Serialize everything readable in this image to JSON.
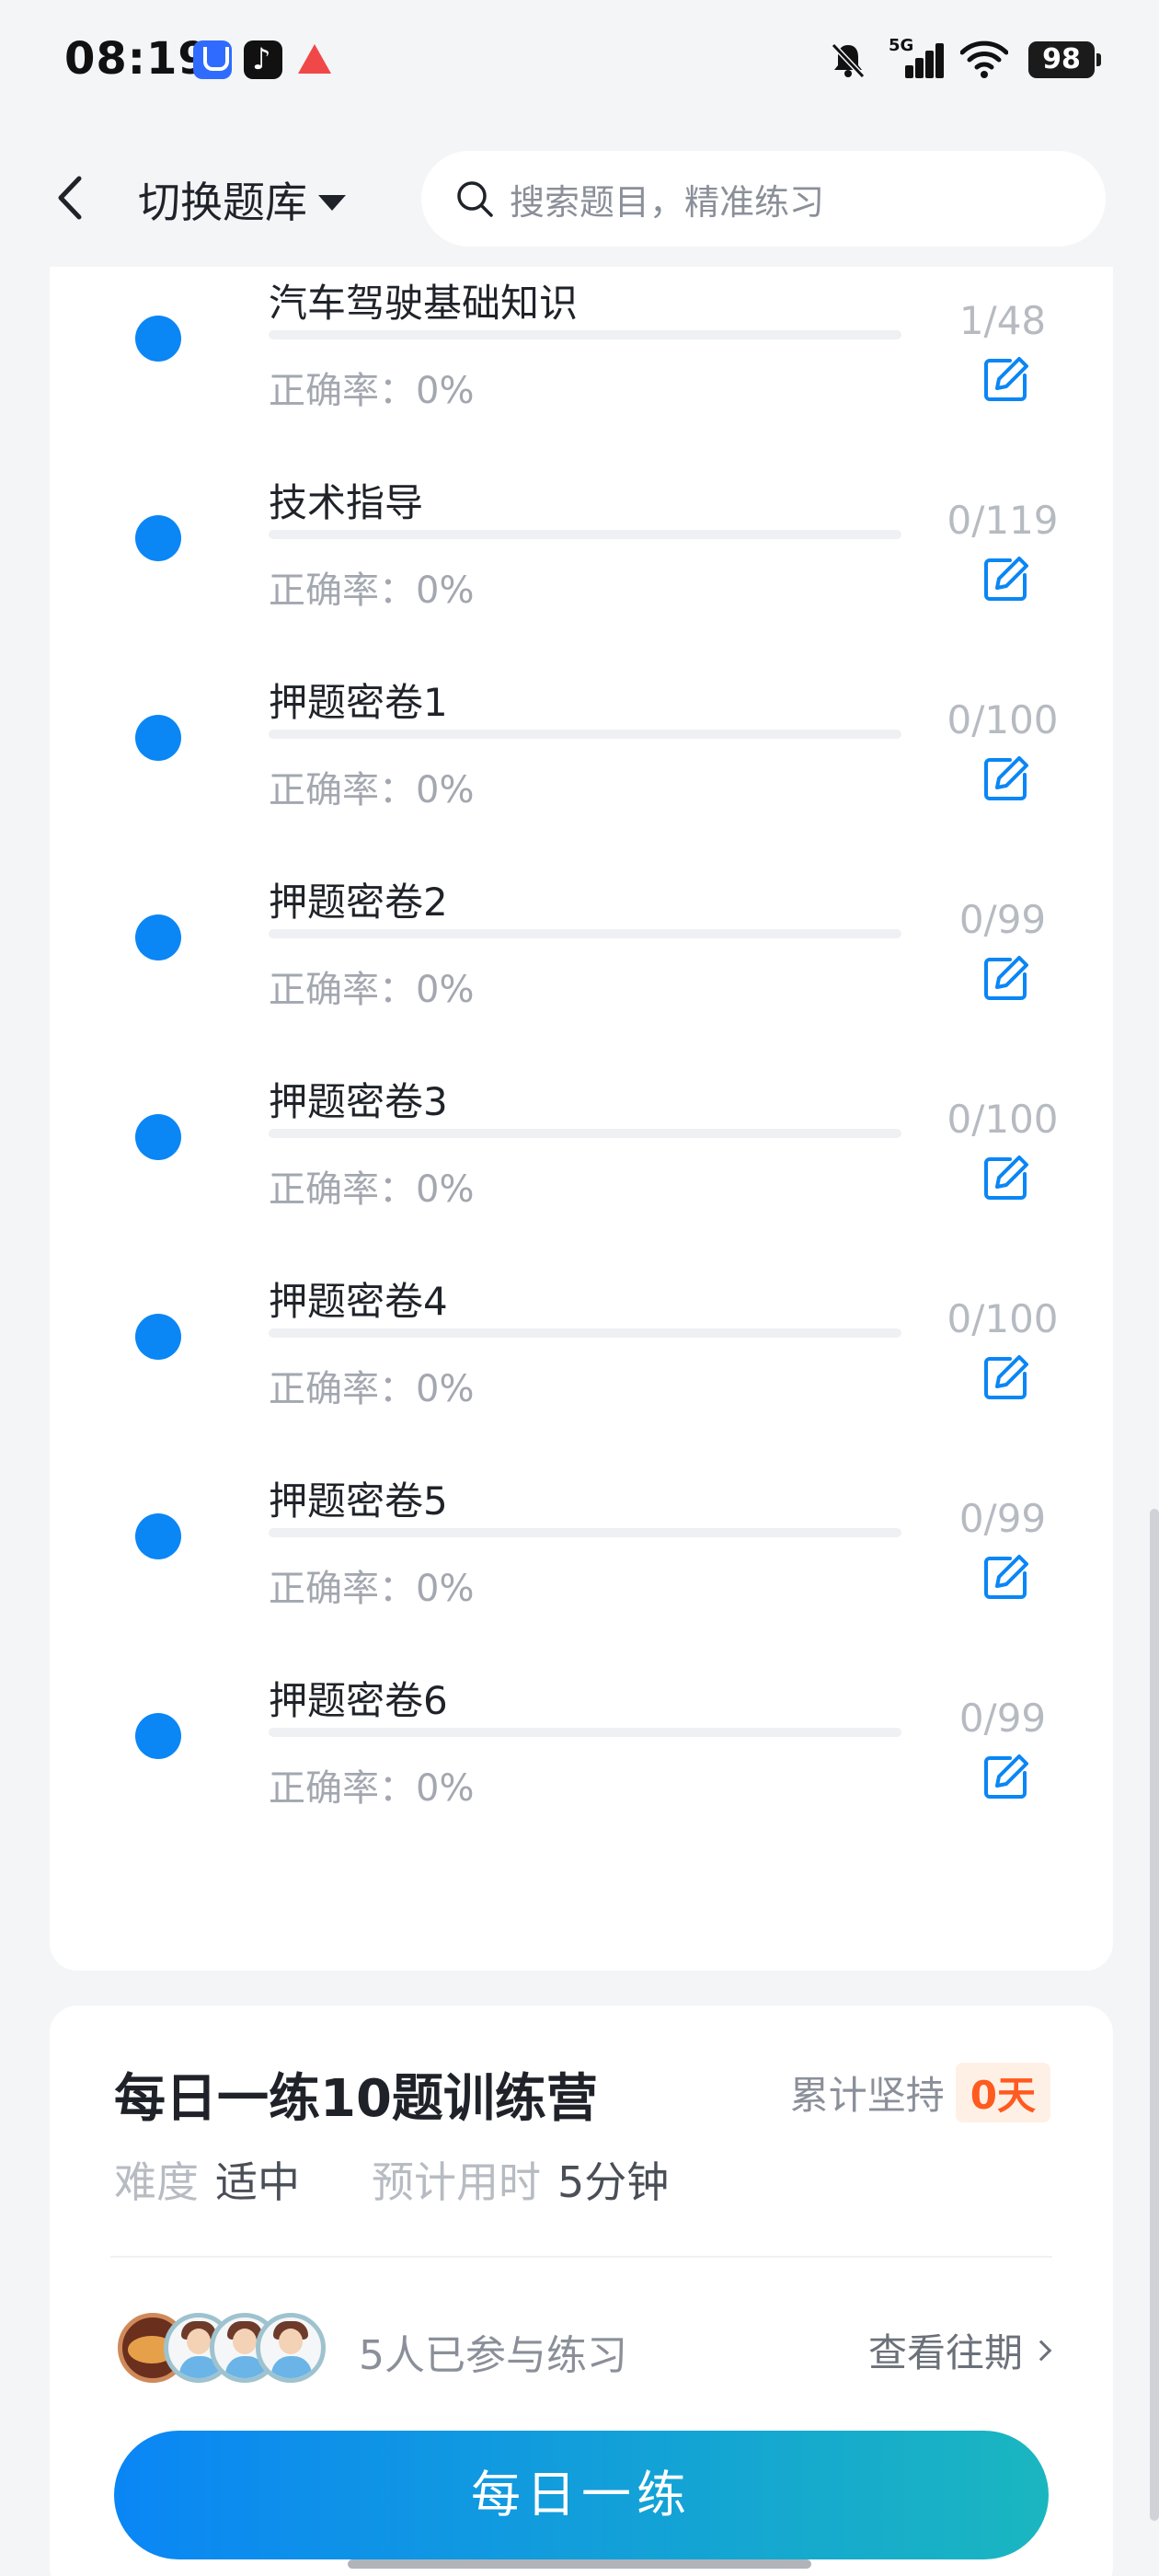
{
  "status_bar": {
    "time": "08:19",
    "network": "5G",
    "battery": "98",
    "app_icons": [
      "shield-app-icon",
      "tiktok-icon",
      "sail-app-icon"
    ]
  },
  "nav": {
    "back_icon": "chevron-left-icon",
    "bank_switch_label": "切换题库",
    "search_placeholder": "搜索题目，精准练习"
  },
  "chapters": [
    {
      "title": "汽车驾驶基础知识",
      "accuracy": "正确率：0%",
      "count": "1/48",
      "progress": 0.021
    },
    {
      "title": "技术指导",
      "accuracy": "正确率：0%",
      "count": "0/119",
      "progress": 0
    },
    {
      "title": "押题密卷1",
      "accuracy": "正确率：0%",
      "count": "0/100",
      "progress": 0
    },
    {
      "title": "押题密卷2",
      "accuracy": "正确率：0%",
      "count": "0/99",
      "progress": 0
    },
    {
      "title": "押题密卷3",
      "accuracy": "正确率：0%",
      "count": "0/100",
      "progress": 0
    },
    {
      "title": "押题密卷4",
      "accuracy": "正确率：0%",
      "count": "0/100",
      "progress": 0
    },
    {
      "title": "押题密卷5",
      "accuracy": "正确率：0%",
      "count": "0/99",
      "progress": 0
    },
    {
      "title": "押题密卷6",
      "accuracy": "正确率：0%",
      "count": "0/99",
      "progress": 0
    }
  ],
  "camp": {
    "title": "每日一练10题训练营",
    "streak_label": "累计坚持",
    "streak_value": "0天",
    "difficulty_label": "难度",
    "difficulty_value": "适中",
    "time_label": "预计用时",
    "time_value": "5分钟",
    "participants": "5人已参与练习",
    "history_link": "查看往期",
    "practice_button": "每日一练"
  },
  "colors": {
    "accent_blue": "#0a86f5",
    "accent_teal": "#1ab6c0",
    "streak_orange": "#ff5a1f"
  }
}
